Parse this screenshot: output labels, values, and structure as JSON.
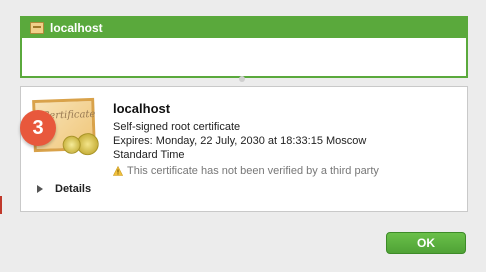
{
  "cert_list": {
    "items": [
      {
        "label": "localhost",
        "selected": true
      }
    ]
  },
  "detail": {
    "name": "localhost",
    "type": "Self-signed root certificate",
    "expires_line1": "Expires: Monday, 22 July, 2030 at 18:33:15 Moscow",
    "expires_line2": "Standard Time",
    "warning": "This certificate has not been verified by a third party",
    "details_label": "Details",
    "certificate_art_text": "Certificate"
  },
  "step_badge": {
    "number": "3"
  },
  "buttons": {
    "ok_label": "OK"
  },
  "colors": {
    "selection_green": "#5aa93c",
    "ok_green": "#55a83a",
    "badge_red": "#e8583c"
  },
  "icons": {
    "list_item_icon": "certificate-icon",
    "detail_icon": "certificate-icon",
    "warning_icon": "warning-icon",
    "disclosure_icon": "disclosure-triangle-icon"
  }
}
